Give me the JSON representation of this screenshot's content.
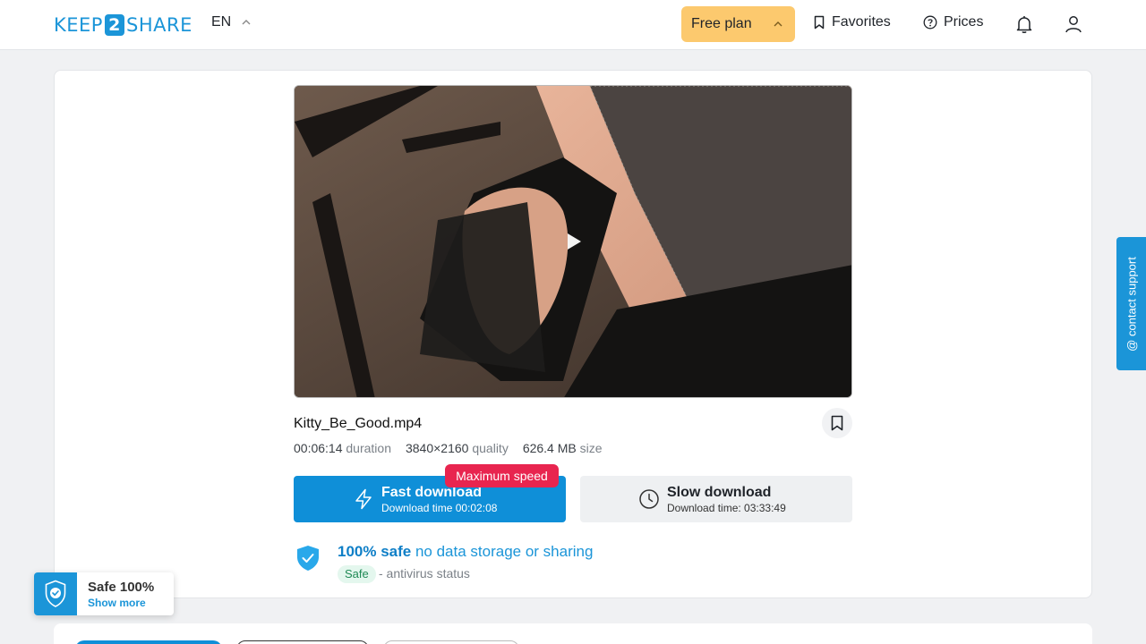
{
  "header": {
    "logo_left": "KEEP",
    "logo_mid": "2",
    "logo_right": "SHARE",
    "language": "EN",
    "plan_label": "Free plan",
    "favorites_label": "Favorites",
    "prices_label": "Prices"
  },
  "file": {
    "name": "Kitty_Be_Good.mp4",
    "duration_value": "00:06:14",
    "duration_label": "duration",
    "quality_value": "3840×2160",
    "quality_label": "quality",
    "size_value": "626.4 MB",
    "size_label": "size"
  },
  "download": {
    "badge": "Maximum speed",
    "fast_title": "Fast download",
    "fast_subtitle": "Download time 00:02:08",
    "slow_title": "Slow download",
    "slow_subtitle": "Download time: 03:33:49"
  },
  "safety": {
    "bold": "100% safe",
    "text": " no data storage or sharing",
    "pill": "Safe",
    "status": "- antivirus status"
  },
  "support": {
    "label": "@ contact support"
  },
  "widget": {
    "title": "Safe 100%",
    "link": "Show more"
  },
  "colors": {
    "accent": "#1b95d8",
    "plan": "#fcc96e",
    "badge": "#e8254f"
  },
  "icons": {
    "plan": "chevron-up-icon",
    "favorites": "bookmark-icon",
    "prices": "question-circle-icon",
    "notifications": "bell-icon",
    "account": "user-icon"
  }
}
